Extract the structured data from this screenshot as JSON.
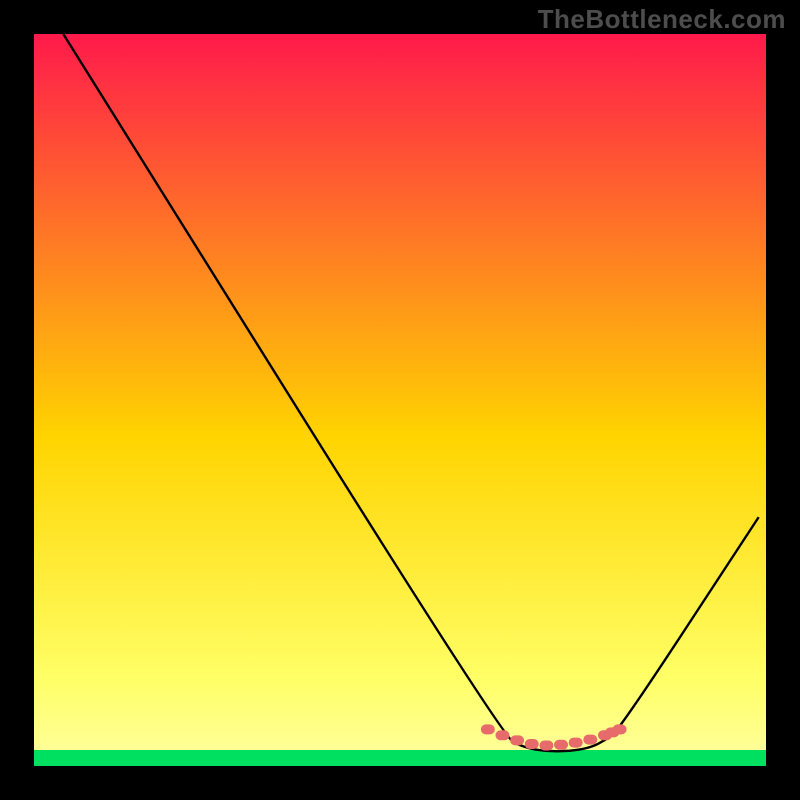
{
  "watermark": "TheBottleneck.com",
  "colors": {
    "top": "#ff1a4b",
    "mid": "#ffd400",
    "low": "#ffff66",
    "bottom_band": "#00e060",
    "curve": "#000000",
    "dot": "#e86b6b"
  },
  "chart_data": {
    "type": "line",
    "title": "",
    "xlabel": "",
    "ylabel": "",
    "xlim": [
      0,
      100
    ],
    "ylim": [
      0,
      100
    ],
    "series": [
      {
        "name": "curve",
        "x": [
          4,
          64,
          67,
          70,
          73,
          76,
          78,
          80,
          99
        ],
        "y": [
          100,
          4,
          2.5,
          2,
          2,
          2.5,
          3.5,
          5,
          34
        ]
      }
    ],
    "optimal_zone": {
      "x": [
        62,
        64,
        66,
        68,
        70,
        72,
        74,
        76,
        78,
        79,
        80
      ],
      "y": [
        5.0,
        4.2,
        3.5,
        3.0,
        2.8,
        2.9,
        3.2,
        3.6,
        4.2,
        4.6,
        5.0
      ]
    },
    "annotations": []
  }
}
